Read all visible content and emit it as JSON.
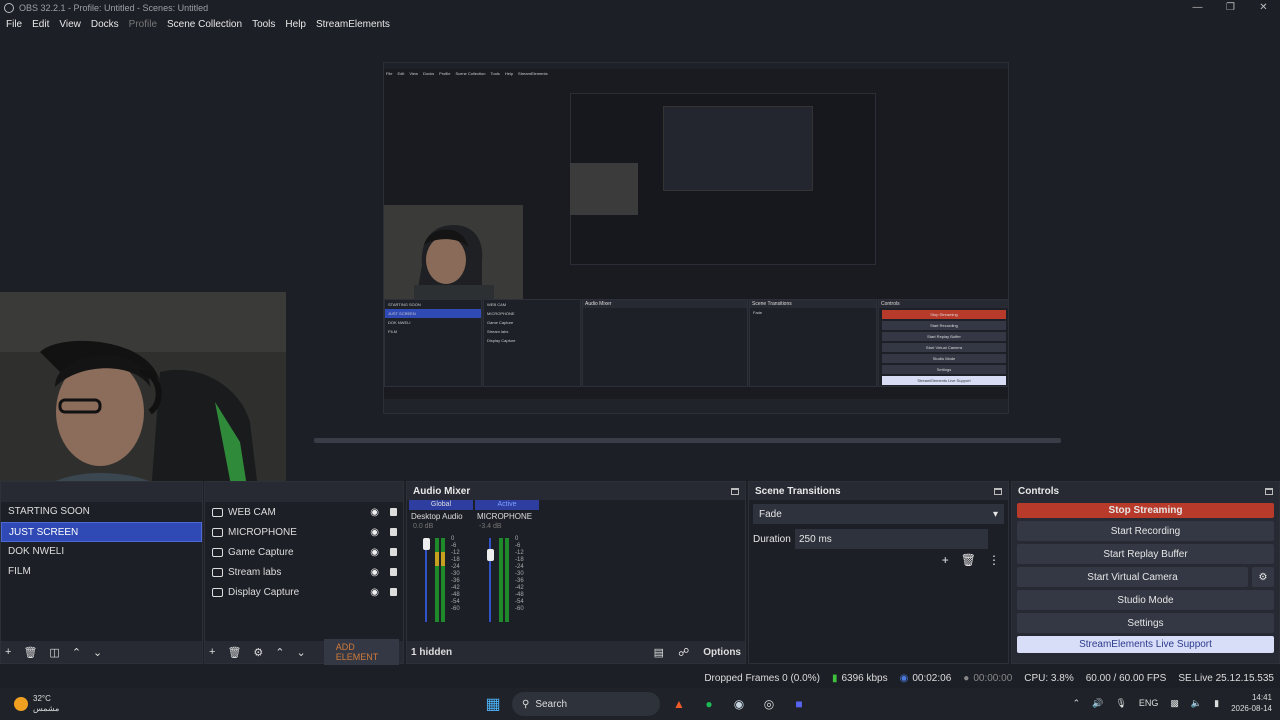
{
  "window": {
    "title": "OBS 32.2.1 - Profile: Untitled - Scenes: Untitled"
  },
  "menu": [
    "File",
    "Edit",
    "View",
    "Docks",
    "Profile",
    "Scene Collection",
    "Tools",
    "Help",
    "StreamElements"
  ],
  "nested_menu": [
    "File",
    "Edit",
    "View",
    "Docks",
    "Profile",
    "Scene Collection",
    "Tools",
    "Help",
    "StreamElements"
  ],
  "nested_scenes": [
    "STARTING SOON",
    "JUST SCREEN",
    "DOK NWELI",
    "FILM"
  ],
  "nested_sources": [
    "WEB CAM",
    "MICROPHONE",
    "Game Capture",
    "Stream labs",
    "Display Capture"
  ],
  "nested_controls": [
    "Stop Streaming",
    "Start Recording",
    "Start Replay Buffer",
    "Start Virtual Camera",
    "Studio Mode",
    "Settings",
    "StreamElements Live Support"
  ],
  "scenes": {
    "items": [
      "STARTING SOON",
      "JUST SCREEN",
      "DOK NWELI",
      "FILM"
    ]
  },
  "sources": {
    "items": [
      "WEB CAM",
      "MICROPHONE",
      "Game Capture",
      "Stream labs",
      "Display Capture"
    ],
    "add_element": "ADD ELEMENT"
  },
  "mixer": {
    "title": "Audio Mixer",
    "tabs": [
      "Global",
      "Active"
    ],
    "channels": [
      {
        "name": "Desktop Audio",
        "db": "0.0 dB",
        "level": 0.55
      },
      {
        "name": "MICROPHONE",
        "db": "-3.4 dB",
        "level": 0.85
      }
    ],
    "scale": [
      "0",
      "-6",
      "-12",
      "-18",
      "-24",
      "-30",
      "-36",
      "-42",
      "-48",
      "-54",
      "-60"
    ],
    "hidden": "1 hidden",
    "options": "Options"
  },
  "transitions": {
    "title": "Scene Transitions",
    "selected": "Fade",
    "duration_label": "Duration",
    "duration_value": "250 ms"
  },
  "controls": {
    "title": "Controls",
    "stop_streaming": "Stop Streaming",
    "start_recording": "Start Recording",
    "start_replay": "Start Replay Buffer",
    "start_virtual": "Start Virtual Camera",
    "studio_mode": "Studio Mode",
    "settings": "Settings",
    "se_support": "StreamElements Live Support"
  },
  "status": {
    "dropped": "Dropped Frames 0 (0.0%)",
    "bitrate": "6396 kbps",
    "stream_time": "00:02:06",
    "rec_time": "00:00:00",
    "cpu": "CPU: 3.8%",
    "fps": "60.00 / 60.00 FPS",
    "se_version": "SE.Live 25.12.15.535"
  },
  "taskbar": {
    "temp": "32°C",
    "weather": "مشمس",
    "search": "Search",
    "lang": "ENG",
    "time": "14:41",
    "date": "2026-08-14"
  }
}
